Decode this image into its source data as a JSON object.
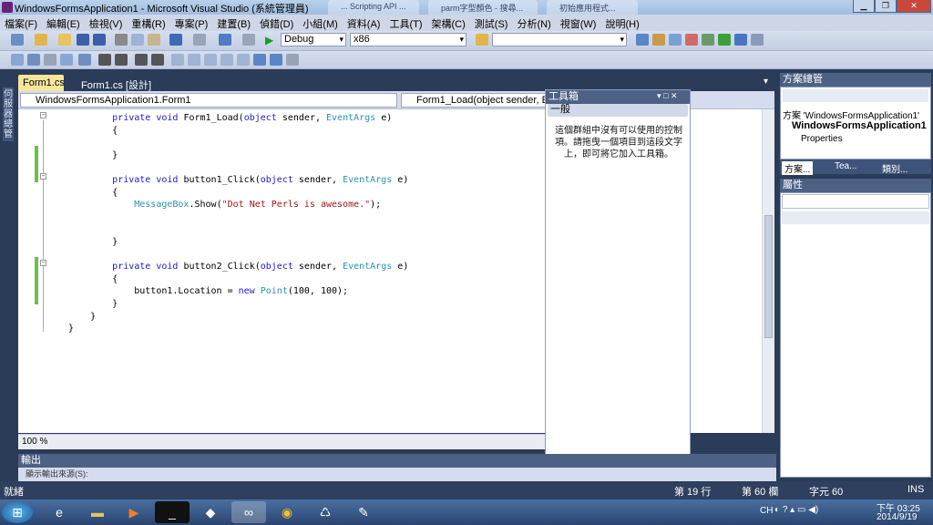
{
  "window": {
    "title": "WindowsFormsApplication1 - Microsoft Visual Studio (系統管理員)",
    "bg_tabs": [
      "... Scripting API ...",
      "parm字型顏色 - 搜尋...",
      "初始應用程式..."
    ]
  },
  "menu": [
    "檔案(F)",
    "編輯(E)",
    "檢視(V)",
    "重構(R)",
    "專案(P)",
    "建置(B)",
    "偵錯(D)",
    "小組(M)",
    "資料(A)",
    "工具(T)",
    "架構(C)",
    "測試(S)",
    "分析(N)",
    "視窗(W)",
    "說明(H)"
  ],
  "toolbar": {
    "config": "Debug",
    "platform": "x86",
    "find": ""
  },
  "leftstrip": {
    "label": "伺服器總管"
  },
  "tabs": {
    "active": "Form1.cs",
    "second": "Form1.cs [設計]"
  },
  "nav": {
    "class": "WindowsFormsApplication1.Form1",
    "member": "Form1_Load(object sender, EventArgs e)"
  },
  "code": [
    [
      [
        "        ",
        ""
      ],
      [
        "private ",
        "kw"
      ],
      [
        "void ",
        "kw"
      ],
      [
        "Form1_Load(",
        ""
      ],
      [
        "object ",
        "kw"
      ],
      [
        "sender, ",
        ""
      ],
      [
        "EventArgs ",
        "ty"
      ],
      [
        "e)",
        ""
      ]
    ],
    [
      [
        "        {",
        ""
      ]
    ],
    [
      [
        "",
        ""
      ]
    ],
    [
      [
        "        }",
        ""
      ]
    ],
    [
      [
        "",
        ""
      ]
    ],
    [
      [
        "        ",
        ""
      ],
      [
        "private ",
        "kw"
      ],
      [
        "void ",
        "kw"
      ],
      [
        "button1_Click(",
        ""
      ],
      [
        "object ",
        "kw"
      ],
      [
        "sender, ",
        ""
      ],
      [
        "EventArgs ",
        "ty"
      ],
      [
        "e)",
        ""
      ]
    ],
    [
      [
        "        {",
        ""
      ]
    ],
    [
      [
        "            ",
        ""
      ],
      [
        "MessageBox",
        "ty"
      ],
      [
        ".Show(",
        ""
      ],
      [
        "\"Dot Net Perls is awesome.\"",
        "st"
      ],
      [
        ");",
        ""
      ]
    ],
    [
      [
        "",
        ""
      ]
    ],
    [
      [
        "",
        ""
      ]
    ],
    [
      [
        "        }",
        ""
      ]
    ],
    [
      [
        "",
        ""
      ]
    ],
    [
      [
        "        ",
        ""
      ],
      [
        "private ",
        "kw"
      ],
      [
        "void ",
        "kw"
      ],
      [
        "button2_Click(",
        ""
      ],
      [
        "object ",
        "kw"
      ],
      [
        "sender, ",
        ""
      ],
      [
        "EventArgs ",
        "ty"
      ],
      [
        "e)",
        ""
      ]
    ],
    [
      [
        "        {",
        ""
      ]
    ],
    [
      [
        "            button1.Location = ",
        ""
      ],
      [
        "new ",
        "kw"
      ],
      [
        "Point",
        "ty"
      ],
      [
        "(100, 100);",
        ""
      ]
    ],
    [
      [
        "        }",
        ""
      ]
    ],
    [
      [
        "    }",
        ""
      ]
    ],
    [
      [
        "}",
        ""
      ]
    ]
  ],
  "zoom": "100 %",
  "toolbox": {
    "title": "工具箱",
    "group": "一般",
    "message": "這個群組中沒有可以使用的控制項。請拖曳一個項目到這段文字上，即可將它加入工具箱。"
  },
  "solution": {
    "title": "方案總管",
    "line1": "方案 'WindowsFormsApplication1'",
    "line2": "WindowsFormsApplication1",
    "line3": "Properties",
    "tab1": "方案...",
    "tab2": "Tea...",
    "tab3": "類別..."
  },
  "properties": {
    "title": "屬性"
  },
  "output": {
    "title": "輸出",
    "sub": "顯示輸出來源(S):"
  },
  "status": {
    "ready": "就緒",
    "line": "第 19 行",
    "col": "第 60 欄",
    "ch": "字元 60",
    "ins": "INS"
  },
  "tray": {
    "lang": "CH",
    "time": "下午 03:25",
    "date": "2014/9/19"
  }
}
